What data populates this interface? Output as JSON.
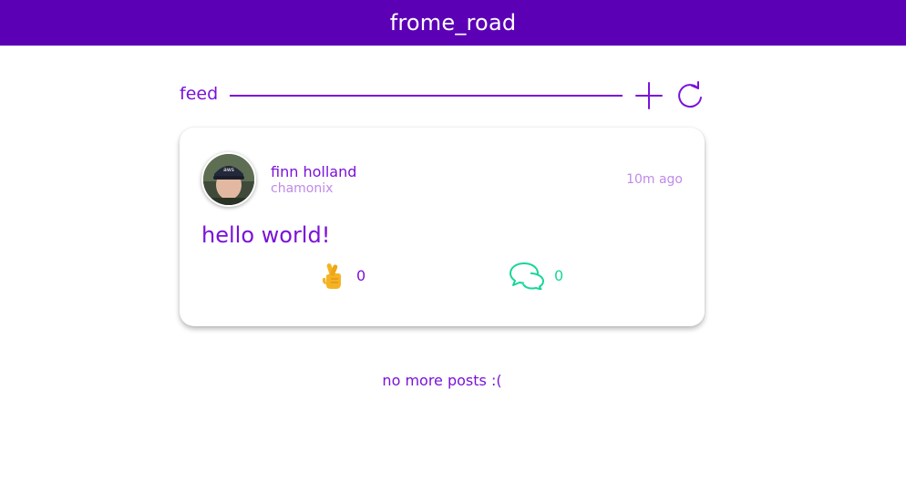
{
  "app": {
    "title": "frome_road",
    "accent_color": "#7a12d9",
    "header_color": "#5b00b5"
  },
  "feed": {
    "label": "feed",
    "add_icon": "plus-icon",
    "refresh_icon": "refresh-icon"
  },
  "posts": [
    {
      "author": "finn holland",
      "location": "chamonix",
      "time": "10m ago",
      "body": "hello world!",
      "fingers_crossed_count": "0",
      "comment_count": "0",
      "fingers_icon": "crossed-fingers-icon",
      "comment_icon": "comment-bubbles-icon"
    }
  ],
  "footer": {
    "end_text": "no more posts :("
  }
}
